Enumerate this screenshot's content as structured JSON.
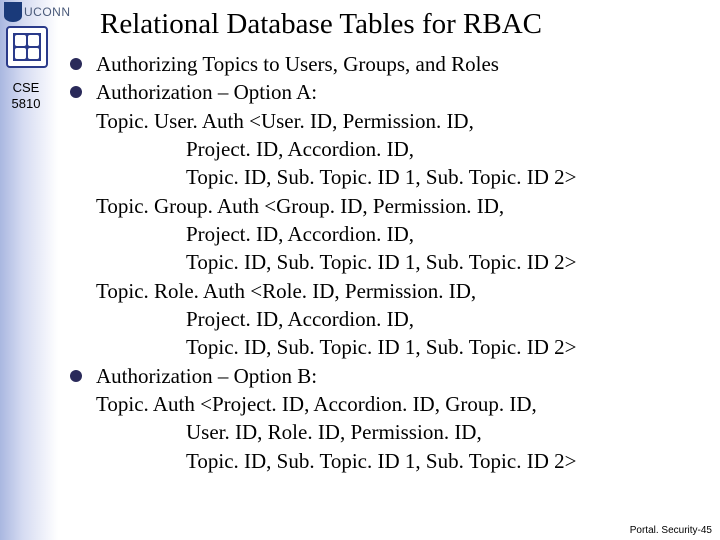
{
  "org": {
    "name": "UCONN"
  },
  "course": {
    "code_line1": "CSE",
    "code_line2": "5810"
  },
  "title": "Relational Database Tables for RBAC",
  "bullets": {
    "b1": "Authorizing Topics to Users, Groups, and Roles",
    "b2": "Authorization – Option A:",
    "b2_lines": {
      "l1": "Topic. User. Auth <User. ID, Permission. ID,",
      "l2": "Project. ID, Accordion. ID,",
      "l3": "Topic. ID, Sub. Topic. ID 1, Sub. Topic. ID 2>",
      "l4": "Topic. Group. Auth <Group. ID, Permission. ID,",
      "l5": "Project. ID, Accordion. ID,",
      "l6": "Topic. ID, Sub. Topic. ID 1, Sub. Topic. ID 2>",
      "l7": "Topic. Role. Auth <Role. ID, Permission. ID,",
      "l8": " Project. ID, Accordion. ID,",
      "l9": "Topic. ID, Sub. Topic. ID 1, Sub. Topic. ID 2>"
    },
    "b3": "Authorization – Option B:",
    "b3_lines": {
      "l1": "Topic. Auth <Project. ID, Accordion. ID, Group. ID,",
      "l2": "User. ID, Role. ID, Permission. ID,",
      "l3": "Topic. ID, Sub. Topic. ID 1, Sub. Topic. ID 2>"
    }
  },
  "footer": "Portal. Security-45"
}
